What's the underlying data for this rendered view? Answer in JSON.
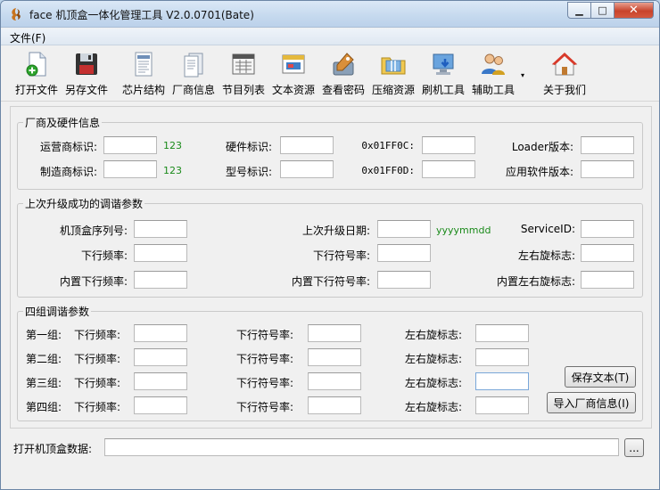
{
  "window": {
    "title": "face 机顶盒一体化管理工具 V2.0.0701(Bate)",
    "min_glyph": "▁",
    "max_glyph": "□",
    "close_glyph": "✕"
  },
  "menu": {
    "file": "文件(F)"
  },
  "toolbar": {
    "open_file": "打开文件",
    "save_as": "另存文件",
    "chip_structure": "芯片结构",
    "vendor_info": "厂商信息",
    "program_list": "节目列表",
    "text_resource": "文本资源",
    "view_password": "查看密码",
    "compress_resource": "压缩资源",
    "flash_tool": "刷机工具",
    "aux_tool": "辅助工具",
    "aux_caret": "▾",
    "about": "关于我们"
  },
  "vendor_section": {
    "legend": "厂商及硬件信息",
    "operator_id_label": "运营商标识:",
    "operator_id_value": "",
    "operator_hint": "123",
    "manufacturer_id_label": "制造商标识:",
    "manufacturer_id_value": "",
    "manufacturer_hint": "123",
    "hardware_id_label": "硬件标识:",
    "hardware_id_value": "",
    "model_id_label": "型号标识:",
    "model_id_value": "",
    "addr_c_label": "0x01FF0C:",
    "addr_c_value": "",
    "addr_d_label": "0x01FF0D:",
    "addr_d_value": "",
    "loader_version_label": "Loader版本:",
    "loader_version_value": "",
    "app_version_label": "应用软件版本:",
    "app_version_value": ""
  },
  "upgrade_section": {
    "legend": "上次升级成功的调谐参数",
    "serial_label": "机顶盒序列号:",
    "serial_value": "",
    "down_freq_label": "下行频率:",
    "down_freq_value": "",
    "builtin_freq_label": "内置下行频率:",
    "builtin_freq_value": "",
    "last_date_label": "上次升级日期:",
    "last_date_value": "",
    "date_hint": "yyyymmdd",
    "symbol_rate_label": "下行符号率:",
    "symbol_rate_value": "",
    "builtin_symbol_label": "内置下行符号率:",
    "builtin_symbol_value": "",
    "service_id_label": "ServiceID:",
    "service_id_value": "",
    "polarization_label": "左右旋标志:",
    "polarization_value": "",
    "builtin_polarization_label": "内置左右旋标志:",
    "builtin_polarization_value": ""
  },
  "four_groups": {
    "legend": "四组调谐参数",
    "freq_label": "下行频率:",
    "symbol_label": "下行符号率:",
    "polar_label": "左右旋标志:",
    "rows": [
      {
        "name": "第一组:",
        "freq": "",
        "symbol": "",
        "polar": ""
      },
      {
        "name": "第二组:",
        "freq": "",
        "symbol": "",
        "polar": ""
      },
      {
        "name": "第三组:",
        "freq": "",
        "symbol": "",
        "polar": ""
      },
      {
        "name": "第四组:",
        "freq": "",
        "symbol": "",
        "polar": ""
      }
    ],
    "save_text_button": "保存文本(T)",
    "import_vendor_button": "导入厂商信息(I)"
  },
  "bottom": {
    "open_data_label": "打开机顶盒数据:",
    "open_data_value": "",
    "browse_button": "..."
  }
}
